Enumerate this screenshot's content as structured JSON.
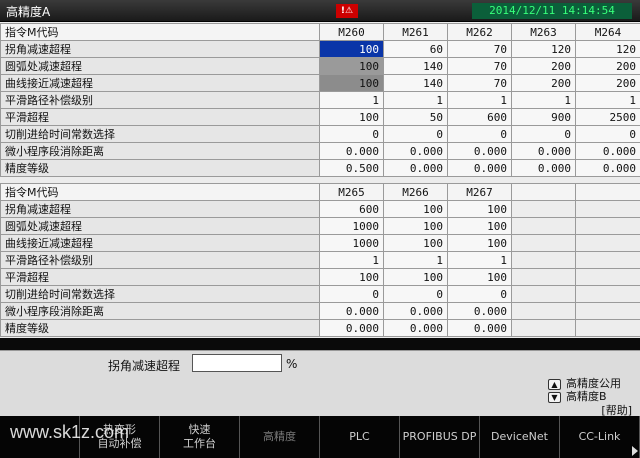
{
  "titlebar": {
    "title": "高精度A",
    "warning_icon": "warning-icon",
    "datetime": "2014/12/11 14:14:54"
  },
  "table1": {
    "header": "指令M代码",
    "columns": [
      "M260",
      "M261",
      "M262",
      "M263",
      "M264"
    ],
    "rows": [
      {
        "label": "拐角减速超程",
        "values": [
          "100",
          "60",
          "70",
          "120",
          "120"
        ]
      },
      {
        "label": "圆弧处减速超程",
        "values": [
          "100",
          "140",
          "70",
          "200",
          "200"
        ]
      },
      {
        "label": "曲线接近减速超程",
        "values": [
          "100",
          "140",
          "70",
          "200",
          "200"
        ]
      },
      {
        "label": "平滑路径补偿级别",
        "values": [
          "1",
          "1",
          "1",
          "1",
          "1"
        ]
      },
      {
        "label": "平滑超程",
        "values": [
          "100",
          "50",
          "600",
          "900",
          "2500"
        ]
      },
      {
        "label": "切削进给时间常数选择",
        "values": [
          "0",
          "0",
          "0",
          "0",
          "0"
        ]
      },
      {
        "label": "微小程序段消除距离",
        "values": [
          "0.000",
          "0.000",
          "0.000",
          "0.000",
          "0.000"
        ]
      },
      {
        "label": "精度等级",
        "values": [
          "0.500",
          "0.000",
          "0.000",
          "0.000",
          "0.000"
        ]
      }
    ]
  },
  "table2": {
    "header": "指令M代码",
    "columns": [
      "M265",
      "M266",
      "M267",
      "",
      ""
    ],
    "rows": [
      {
        "label": "拐角减速超程",
        "values": [
          "600",
          "100",
          "100",
          "",
          ""
        ]
      },
      {
        "label": "圆弧处减速超程",
        "values": [
          "1000",
          "100",
          "100",
          "",
          ""
        ]
      },
      {
        "label": "曲线接近减速超程",
        "values": [
          "1000",
          "100",
          "100",
          "",
          ""
        ]
      },
      {
        "label": "平滑路径补偿级别",
        "values": [
          "1",
          "1",
          "1",
          "",
          ""
        ]
      },
      {
        "label": "平滑超程",
        "values": [
          "100",
          "100",
          "100",
          "",
          ""
        ]
      },
      {
        "label": "切削进给时间常数选择",
        "values": [
          "0",
          "0",
          "0",
          "",
          ""
        ]
      },
      {
        "label": "微小程序段消除距离",
        "values": [
          "0.000",
          "0.000",
          "0.000",
          "",
          ""
        ]
      },
      {
        "label": "精度等级",
        "values": [
          "0.000",
          "0.000",
          "0.000",
          "",
          ""
        ]
      }
    ]
  },
  "input": {
    "label": "拐角减速超程",
    "value": "",
    "unit": "%"
  },
  "pager": {
    "prev_label": "高精度公用",
    "next_label": "高精度B",
    "help_label": "[帮助]"
  },
  "fkeys": [
    "",
    "热变形\n自动补偿",
    "快速\n工作台",
    "高精度",
    "PLC",
    "PROFIBUS DP",
    "DeviceNet",
    "CC-Link"
  ],
  "watermark": "www.sk1z.com"
}
